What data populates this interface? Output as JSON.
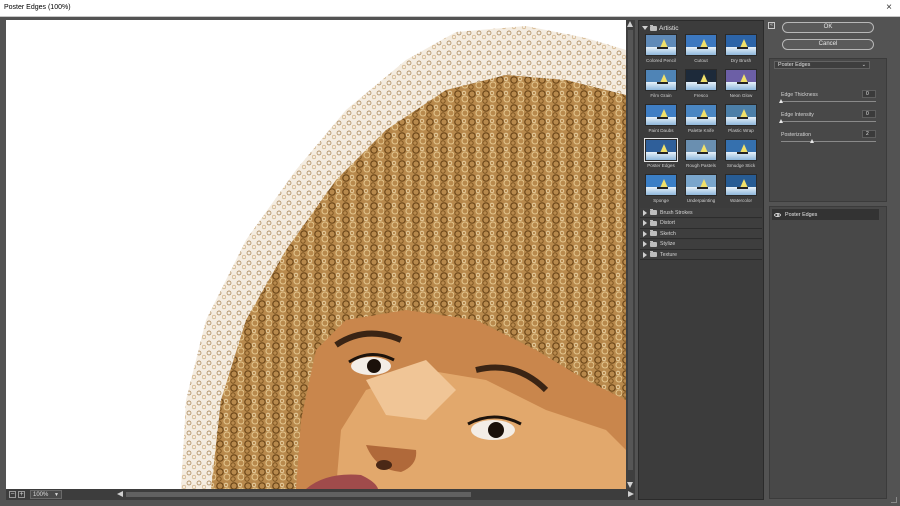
{
  "window": {
    "title": "Poster Edges (100%)",
    "close_glyph": "×"
  },
  "preview": {
    "zoom_value": "100%",
    "zoom_out_glyph": "−",
    "zoom_in_glyph": "+"
  },
  "gallery": {
    "open_category": "Artistic",
    "filters": [
      {
        "label": "Colored Pencil",
        "tint": "#5f8ab8"
      },
      {
        "label": "Cutout",
        "tint": "#3c78c0"
      },
      {
        "label": "Dry Brush",
        "tint": "#2c64a8"
      },
      {
        "label": "Film Grain",
        "tint": "#4f84b6"
      },
      {
        "label": "Fresco",
        "tint": "#1d2a3a"
      },
      {
        "label": "Neon Glow",
        "tint": "#6c5fa6"
      },
      {
        "label": "Paint Daubs",
        "tint": "#3f7ec4"
      },
      {
        "label": "Palette Knife",
        "tint": "#4a86c2"
      },
      {
        "label": "Plastic Wrap",
        "tint": "#4c7fa8"
      },
      {
        "label": "Poster Edges",
        "tint": "#2f5f9a"
      },
      {
        "label": "Rough Pastels",
        "tint": "#6a8fb0"
      },
      {
        "label": "Smudge Stick",
        "tint": "#3570ae"
      },
      {
        "label": "Sponge",
        "tint": "#3b7fc6"
      },
      {
        "label": "Underpainting",
        "tint": "#7aa6cc"
      },
      {
        "label": "Watercolor",
        "tint": "#275c94"
      }
    ],
    "selected_filter": "Poster Edges",
    "collapsed_categories": [
      "Brush Strokes",
      "Distort",
      "Sketch",
      "Stylize",
      "Texture"
    ]
  },
  "actions": {
    "ok_label": "OK",
    "cancel_label": "Cancel",
    "collapse_glyph": "«"
  },
  "settings": {
    "filter_select": "Poster Edges",
    "params": [
      {
        "label": "Edge Thickness",
        "value": "0",
        "fraction": 0.0
      },
      {
        "label": "Edge Intensity",
        "value": "0",
        "fraction": 0.0
      },
      {
        "label": "Posterization",
        "value": "2",
        "fraction": 0.33
      }
    ]
  },
  "layers": {
    "items": [
      "Poster Edges"
    ]
  }
}
